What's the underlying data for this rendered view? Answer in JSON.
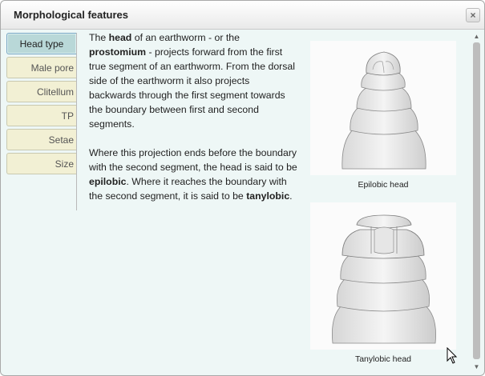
{
  "dialog": {
    "title": "Morphological features",
    "close_icon": "×"
  },
  "tabs": [
    {
      "label": "Head type",
      "active": true
    },
    {
      "label": "Male pore",
      "active": false
    },
    {
      "label": "Clitellum",
      "active": false
    },
    {
      "label": "TP",
      "active": false
    },
    {
      "label": "Setae",
      "active": false
    },
    {
      "label": "Size",
      "active": false
    }
  ],
  "content": {
    "p1": {
      "t1": "The ",
      "head": "head",
      "t2": " of an earthworm - or the ",
      "prostomium": "prostomium",
      "t3": " - projects forward from the first true segment of an earthworm. From the dorsal side of the earthworm it also projects backwards through the first segment towards the boundary between first and second segments."
    },
    "p2": {
      "t1": "Where this projection ends before the boundary with the second segment, the head is said to be ",
      "epilobic": "epilobic",
      "t2": ". Where it reaches the boundary with the second segment, it is said to be ",
      "tanylobic": "tanylobic",
      "t3": "."
    }
  },
  "figures": [
    {
      "caption": "Epilobic head"
    },
    {
      "caption": "Tanylobic head"
    }
  ],
  "scrollbar": {
    "up_icon": "▲",
    "down_icon": "▼"
  },
  "colors": {
    "dialog_bg": "#eef7f6",
    "tab_inactive": "#f2f0d4",
    "tab_active": "#b9d8d8"
  }
}
